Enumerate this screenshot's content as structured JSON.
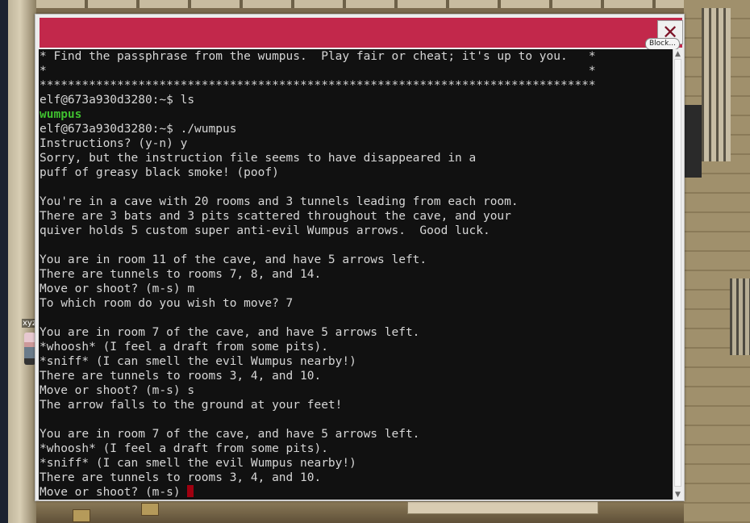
{
  "background": {
    "player_name": "xyz"
  },
  "window": {
    "title": "",
    "title_bar_color": "#c2284b",
    "close_icon": "x-icon",
    "close_glyph": "✕",
    "block_label": "Block..."
  },
  "terminal": {
    "lines": [
      "* Find the passphrase from the wumpus.  Play fair or cheat; it's up to you.   *",
      "*                                                                             *",
      "*******************************************************************************",
      "elf@673a930d3280:~$ ls",
      "wumpus",
      "elf@673a930d3280:~$ ./wumpus",
      "Instructions? (y-n) y",
      "Sorry, but the instruction file seems to have disappeared in a",
      "puff of greasy black smoke! (poof)",
      "",
      "You're in a cave with 20 rooms and 3 tunnels leading from each room.",
      "There are 3 bats and 3 pits scattered throughout the cave, and your",
      "quiver holds 5 custom super anti-evil Wumpus arrows.  Good luck.",
      "",
      "You are in room 11 of the cave, and have 5 arrows left.",
      "There are tunnels to rooms 7, 8, and 14.",
      "Move or shoot? (m-s) m",
      "To which room do you wish to move? 7",
      "",
      "You are in room 7 of the cave, and have 5 arrows left.",
      "*whoosh* (I feel a draft from some pits).",
      "*sniff* (I can smell the evil Wumpus nearby!)",
      "There are tunnels to rooms 3, 4, and 10.",
      "Move or shoot? (m-s) s",
      "The arrow falls to the ground at your feet!",
      "",
      "You are in room 7 of the cave, and have 5 arrows left.",
      "*whoosh* (I feel a draft from some pits).",
      "*sniff* (I can smell the evil Wumpus nearby!)",
      "There are tunnels to rooms 3, 4, and 10."
    ],
    "prompt": "Move or shoot? (m-s) ",
    "colors": {
      "background": "#111111",
      "text": "#d6d6d6",
      "highlight_green": "#3fbf2f",
      "cursor": "#a00010"
    }
  },
  "scrollbar": {
    "up_icon": "▲",
    "down_icon": "▼"
  }
}
